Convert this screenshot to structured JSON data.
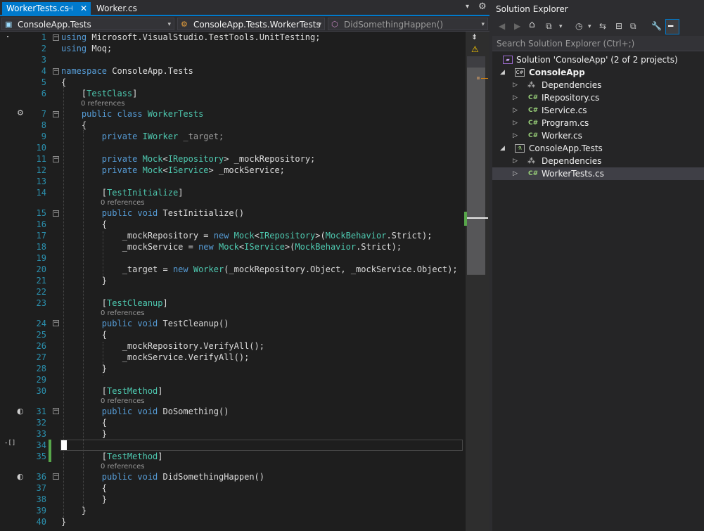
{
  "tabs": {
    "active_label": "WorkerTests.cs",
    "active_pin": "⊣",
    "active_close": "✕",
    "second_label": "Worker.cs",
    "overflow_glyph": "▾",
    "settings_glyph": "⚙"
  },
  "navbar": {
    "project": "ConsoleApp.Tests",
    "class": "ConsoleApp.Tests.WorkerTests",
    "member": "DidSomethingHappen()",
    "dropdown_glyph": "▾"
  },
  "editor": {
    "line_numbers": [
      "1",
      "2",
      "3",
      "4",
      "5",
      "6",
      "7",
      "8",
      "9",
      "10",
      "11",
      "12",
      "13",
      "14",
      "15",
      "16",
      "17",
      "18",
      "19",
      "20",
      "21",
      "22",
      "23",
      "24",
      "25",
      "26",
      "27",
      "28",
      "29",
      "30",
      "31",
      "32",
      "33",
      "34",
      "35",
      "36",
      "37",
      "38",
      "39",
      "40"
    ],
    "lines": {
      "l1_kw": "using",
      "l1_rest": " Microsoft.VisualStudio.TestTools.UnitTesting;",
      "l2_kw": "using",
      "l2_rest": " Moq;",
      "l4_kw": "namespace",
      "l4_rest": " ConsoleApp.Tests",
      "l5": "{",
      "l6_open": "    [",
      "l6_attr": "TestClass",
      "l6_close": "]",
      "l7_kw": "    public class ",
      "l7_type": "WorkerTests",
      "l8": "    {",
      "l9_kw": "        private ",
      "l9_type": "IWorker",
      "l9_rest": " _target;",
      "l11_kw": "        private ",
      "l11_type": "Mock",
      "l11_a": "<",
      "l11_t2": "IRepository",
      "l11_rest": "> _mockRepository;",
      "l12_kw": "        private ",
      "l12_type": "Mock",
      "l12_a": "<",
      "l12_t2": "IService",
      "l12_rest": "> _mockService;",
      "l14_open": "        [",
      "l14_attr": "TestInitialize",
      "l14_close": "]",
      "l15_kw": "        public void",
      "l15_rest": " TestInitialize()",
      "l16": "        {",
      "l17_a": "            _mockRepository = ",
      "l17_kw": "new ",
      "l17_t": "Mock",
      "l17_b": "<",
      "l17_t2": "IRepository",
      "l17_c": ">(",
      "l17_t3": "MockBehavior",
      "l17_d": ".Strict);",
      "l18_a": "            _mockService = ",
      "l18_kw": "new ",
      "l18_t": "Mock",
      "l18_b": "<",
      "l18_t2": "IService",
      "l18_c": ">(",
      "l18_t3": "MockBehavior",
      "l18_d": ".Strict);",
      "l20_a": "            _target = ",
      "l20_kw": "new ",
      "l20_t": "Worker",
      "l20_b": "(_mockRepository.Object, _mockService.Object);",
      "l21": "        }",
      "l23_open": "        [",
      "l23_attr": "TestCleanup",
      "l23_close": "]",
      "l24_kw": "        public void",
      "l24_rest": " TestCleanup()",
      "l25": "        {",
      "l26": "            _mockRepository.VerifyAll();",
      "l27": "            _mockService.VerifyAll();",
      "l28": "        }",
      "l30_open": "        [",
      "l30_attr": "TestMethod",
      "l30_close": "]",
      "l31_kw": "        public void",
      "l31_rest": " DoSomething()",
      "l32": "        {",
      "l33": "        }",
      "l35_open": "        [",
      "l35_attr": "TestMethod",
      "l35_close": "]",
      "l36_kw": "        public void",
      "l36_rest": " DidSomethingHappen()",
      "l37": "        {",
      "l38": "        }",
      "l39": "    }",
      "l40": "}"
    },
    "references_label": "0 references",
    "fold_glyph": "−",
    "gutter_icons": {
      "class_icon": "⚙",
      "test_icon": "◐",
      "quick_action": "-[]"
    }
  },
  "scrollbar": {
    "split_glyph": "⇟",
    "warning_glyph": "⚠"
  },
  "solution_explorer": {
    "title": "Solution Explorer",
    "search_placeholder": "Search Solution Explorer (Ctrl+;)",
    "toolbar_glyphs": [
      "◀",
      "▶",
      "⌂",
      "⧉",
      "▾",
      "◷",
      "▾",
      "⇆",
      "⊟",
      "⧉",
      "🔧",
      "━"
    ],
    "tree": {
      "solution": "Solution 'ConsoleApp' (2 of 2 projects)",
      "project1": "ConsoleApp",
      "p1_items": [
        "Dependencies",
        "IRepository.cs",
        "IService.cs",
        "Program.cs",
        "Worker.cs"
      ],
      "project2": "ConsoleApp.Tests",
      "p2_items": [
        "Dependencies",
        "WorkerTests.cs"
      ],
      "cs_badge": "C#",
      "expanded_glyph": "◢",
      "collapsed_glyph": "▷"
    }
  },
  "colors": {
    "accent": "#007acc",
    "keyword": "#569cd6",
    "type": "#4ec9b0",
    "line_number": "#2b91af",
    "change_marker": "#57a64a"
  }
}
